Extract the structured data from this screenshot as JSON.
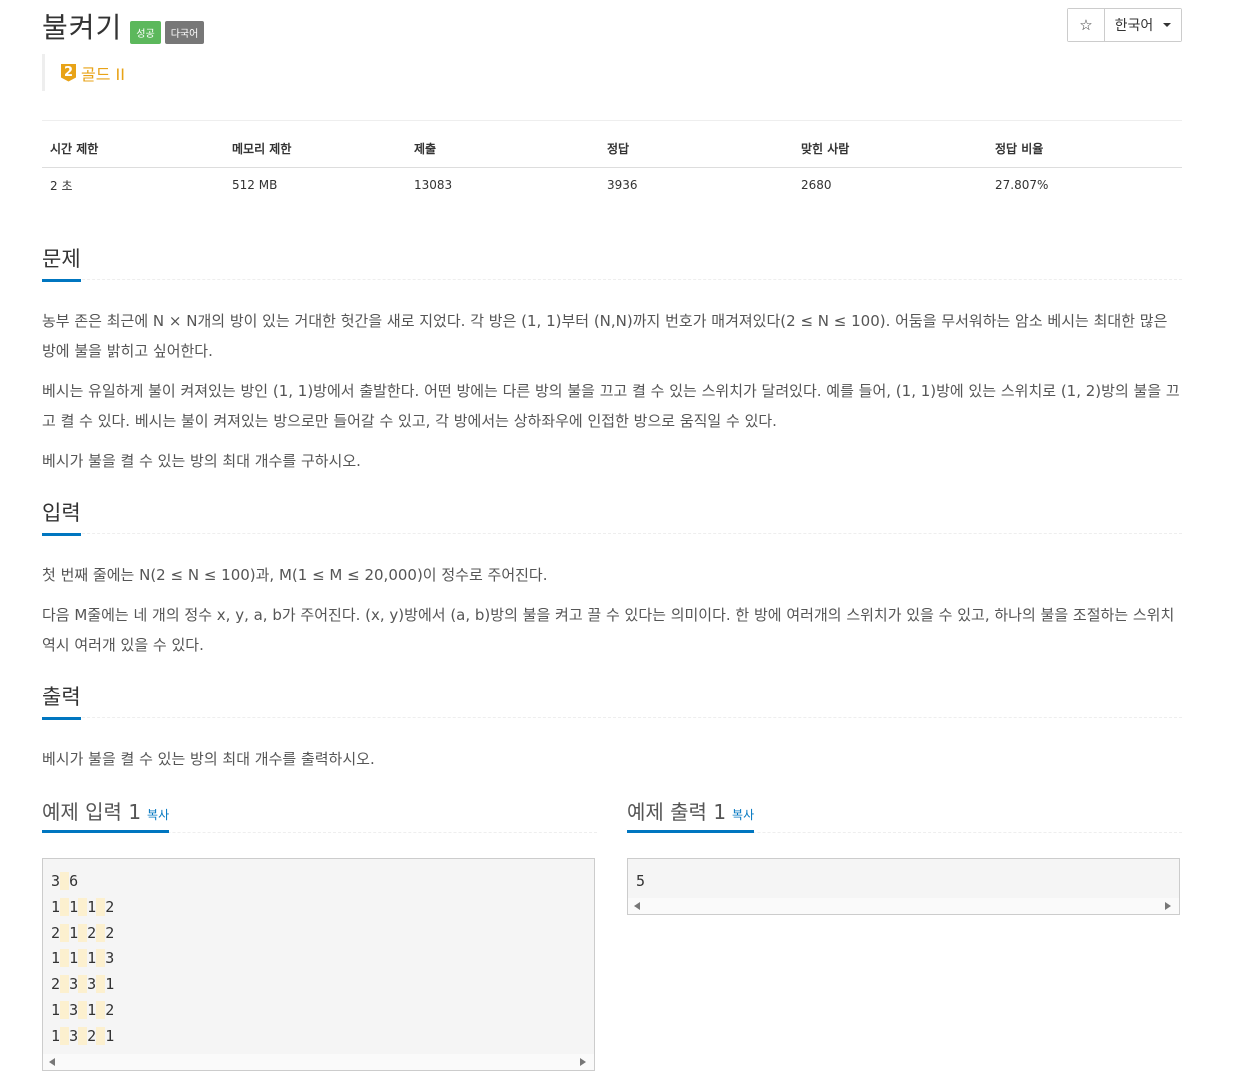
{
  "problem": {
    "title": "불켜기",
    "labels": [
      "성공",
      "다국어"
    ],
    "tier_number": "2",
    "tier_text": "골드 II"
  },
  "toolbar": {
    "star_icon": "☆",
    "language": "한국어"
  },
  "info": {
    "headers": [
      "시간 제한",
      "메모리 제한",
      "제출",
      "정답",
      "맞힌 사람",
      "정답 비율"
    ],
    "values": [
      "2 초",
      "512 MB",
      "13083",
      "3936",
      "2680",
      "27.807%"
    ]
  },
  "sections": {
    "description": {
      "title": "문제",
      "paragraphs": [
        "농부 존은 최근에 N × N개의 방이 있는 거대한 헛간을 새로 지었다. 각 방은 (1, 1)부터 (N,N)까지 번호가 매겨져있다(2 ≤ N ≤ 100). 어둠을 무서워하는 암소 베시는 최대한 많은 방에 불을 밝히고 싶어한다.",
        "베시는 유일하게 불이 켜져있는 방인 (1, 1)방에서 출발한다. 어떤 방에는 다른 방의 불을 끄고 켤 수 있는 스위치가 달려있다. 예를 들어, (1, 1)방에 있는 스위치로 (1, 2)방의 불을 끄고 켤 수 있다. 베시는 불이 켜져있는 방으로만 들어갈 수 있고, 각 방에서는 상하좌우에 인접한 방으로 움직일 수 있다.",
        "베시가 불을 켤 수 있는 방의 최대 개수를 구하시오."
      ]
    },
    "input": {
      "title": "입력",
      "paragraphs": [
        "첫 번째 줄에는 N(2 ≤ N ≤ 100)과, M(1 ≤ M ≤ 20,000)이 정수로 주어진다.",
        "다음 M줄에는 네 개의 정수 x, y, a, b가 주어진다. (x, y)방에서 (a, b)방의 불을 켜고 끌 수 있다는 의미이다. 한 방에 여러개의 스위치가 있을 수 있고, 하나의 불을 조절하는 스위치 역시 여러개 있을 수 있다."
      ]
    },
    "output": {
      "title": "출력",
      "paragraphs": [
        "베시가 불을 켤 수 있는 방의 최대 개수를 출력하시오."
      ]
    }
  },
  "samples": {
    "input": {
      "title": "예제 입력 1",
      "copy_label": "복사",
      "lines": [
        [
          "3",
          "6"
        ],
        [
          "1",
          "1",
          "1",
          "2"
        ],
        [
          "2",
          "1",
          "2",
          "2"
        ],
        [
          "1",
          "1",
          "1",
          "3"
        ],
        [
          "2",
          "3",
          "3",
          "1"
        ],
        [
          "1",
          "3",
          "1",
          "2"
        ],
        [
          "1",
          "3",
          "2",
          "1"
        ]
      ]
    },
    "output": {
      "title": "예제 출력 1",
      "copy_label": "복사",
      "lines": [
        [
          "5"
        ]
      ]
    }
  }
}
